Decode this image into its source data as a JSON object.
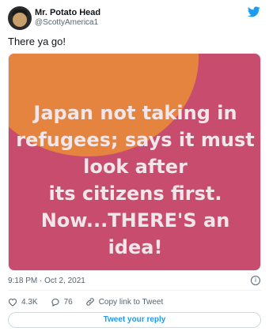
{
  "author": {
    "name": "Mr. Potato Head",
    "handle": "@ScottyAmerica1"
  },
  "tweet": {
    "text": "There ya go!",
    "timestamp": "9:18 PM · Oct 2, 2021"
  },
  "media": {
    "caption_lines": [
      "Japan not taking in",
      "refugees; says it must",
      "look after",
      "its citizens first.",
      "Now...THERE'S an",
      "idea!"
    ],
    "colors": {
      "background": "#c84c6e",
      "accent_blob": "#e5843f",
      "text": "#f2e6ea"
    }
  },
  "actions": {
    "likes": "4.3K",
    "replies": "76",
    "copy_link": "Copy link to Tweet"
  },
  "reply_button": "Tweet your reply",
  "icons": {
    "brand": "twitter-bird-icon",
    "info": "info-icon",
    "like": "heart-icon",
    "reply": "comment-icon",
    "copy": "link-icon"
  },
  "colors": {
    "accent": "#1d9bf0",
    "secondary_text": "#536471"
  }
}
